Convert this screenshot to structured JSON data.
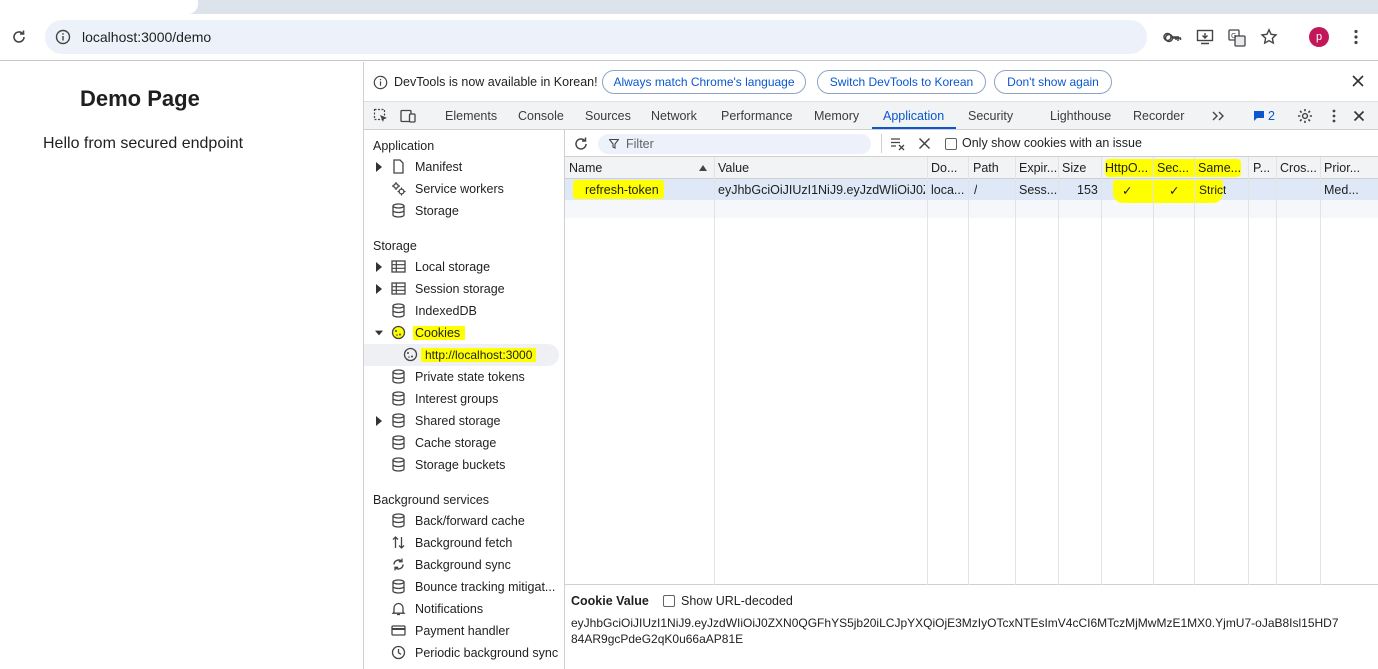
{
  "browser": {
    "url": "localhost:3000/demo",
    "avatar_letter": "p"
  },
  "page": {
    "title": "Demo Page",
    "text": "Hello from secured endpoint"
  },
  "devtools": {
    "infobar": {
      "message": "DevTools is now available in Korean!",
      "buttons": [
        "Always match Chrome's language",
        "Switch DevTools to Korean",
        "Don't show again"
      ]
    },
    "tabs": [
      "Elements",
      "Console",
      "Sources",
      "Network",
      "Performance",
      "Memory",
      "Application",
      "Security",
      "Lighthouse",
      "Recorder"
    ],
    "active_tab": "Application",
    "issues_count": "2",
    "sidebar": {
      "sections": {
        "application": "Application",
        "storage": "Storage",
        "background": "Background services"
      },
      "application_items": [
        "Manifest",
        "Service workers",
        "Storage"
      ],
      "storage_items": [
        "Local storage",
        "Session storage",
        "IndexedDB",
        "Cookies",
        "http://localhost:3000",
        "Private state tokens",
        "Interest groups",
        "Shared storage",
        "Cache storage",
        "Storage buckets"
      ],
      "background_items": [
        "Back/forward cache",
        "Background fetch",
        "Background sync",
        "Bounce tracking mitigat...",
        "Notifications",
        "Payment handler",
        "Periodic background sync"
      ]
    },
    "cookies": {
      "filter_placeholder": "Filter",
      "only_issues_label": "Only show cookies with an issue",
      "columns": [
        "Name",
        "Value",
        "Do...",
        "Path",
        "Expir...",
        "Size",
        "HttpO...",
        "Sec...",
        "Same...",
        "P...",
        "Cros...",
        "Prior..."
      ],
      "rows": [
        {
          "name": "refresh-token",
          "value": "eyJhbGciOiJIUzI1NiJ9.eyJzdWIiOiJ0Z...",
          "domain": "loca...",
          "path": "/",
          "expires": "Sess...",
          "size": "153",
          "httponly": "✓",
          "secure": "✓",
          "samesite": "Strict",
          "partition": "",
          "cross_site": "",
          "priority": "Med..."
        }
      ],
      "cookie_value_title": "Cookie Value",
      "show_decoded_label": "Show URL-decoded",
      "cookie_value": "eyJhbGciOiJIUzI1NiJ9.eyJzdWIiOiJ0ZXN0QGFhYS5jb20iLCJpYXQiOjE3MzIyOTcxNTEsImV4cCI6MTczMjMwMzE1MX0.YjmU7-oJaB8Isl15HD784AR9gcPdeG2qK0u66aAP81E"
    }
  }
}
